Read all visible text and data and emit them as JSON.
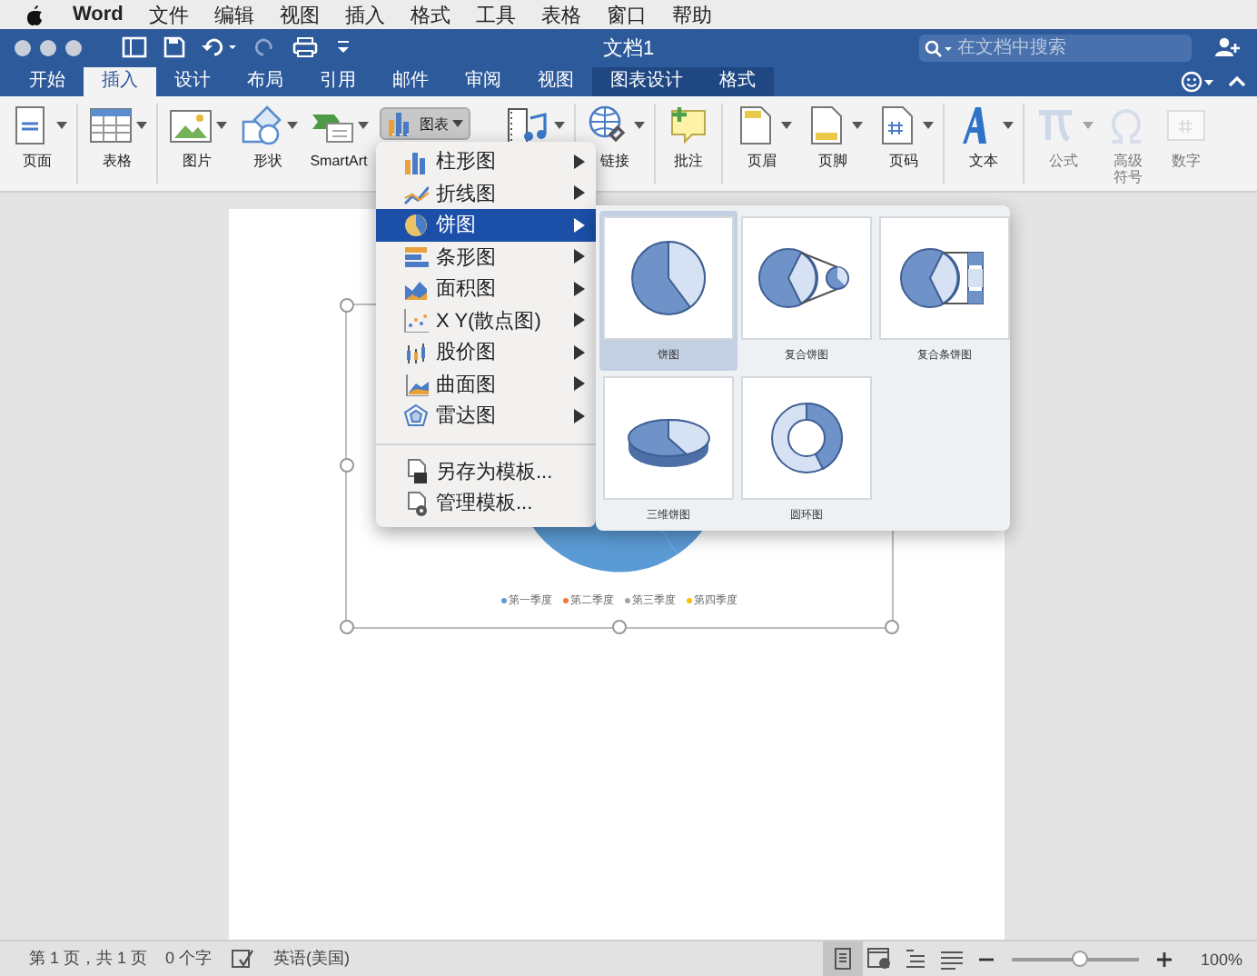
{
  "menu_bar": {
    "app": "Word",
    "items": [
      "文件",
      "编辑",
      "视图",
      "插入",
      "格式",
      "工具",
      "表格",
      "窗口",
      "帮助"
    ]
  },
  "title_bar": {
    "title": "文档1",
    "search": {
      "placeholder": "在文档中搜索"
    }
  },
  "tabs": [
    {
      "label": "开始",
      "selected": false,
      "kind": "normal"
    },
    {
      "label": "插入",
      "selected": true,
      "kind": "normal"
    },
    {
      "label": "设计",
      "selected": false,
      "kind": "normal"
    },
    {
      "label": "布局",
      "selected": false,
      "kind": "normal"
    },
    {
      "label": "引用",
      "selected": false,
      "kind": "normal"
    },
    {
      "label": "邮件",
      "selected": false,
      "kind": "normal"
    },
    {
      "label": "审阅",
      "selected": false,
      "kind": "normal"
    },
    {
      "label": "视图",
      "selected": false,
      "kind": "normal"
    },
    {
      "label": "图表设计",
      "selected": false,
      "kind": "context"
    },
    {
      "label": "格式",
      "selected": false,
      "kind": "context"
    }
  ],
  "ribbon": [
    {
      "label": "页面",
      "kind": "page",
      "has_menu": true,
      "disabled": false,
      "group_end": true
    },
    {
      "label": "表格",
      "kind": "table",
      "has_menu": true,
      "disabled": false,
      "group_end": true
    },
    {
      "label": "图片",
      "kind": "picture",
      "has_menu": true,
      "disabled": false,
      "group_end": false
    },
    {
      "label": "形状",
      "kind": "shapes",
      "has_menu": true,
      "disabled": false,
      "group_end": false
    },
    {
      "label": "SmartArt",
      "kind": "smartart",
      "has_menu": true,
      "disabled": false,
      "group_end": false
    },
    {
      "label": "图表",
      "kind": "chart",
      "has_menu": true,
      "disabled": false,
      "expanded": true,
      "group_end": true
    },
    {
      "kind": "media",
      "has_menu": true,
      "disabled": false,
      "group_end": true
    },
    {
      "label": "链接",
      "kind": "link",
      "has_menu": true,
      "disabled": false,
      "group_end": true
    },
    {
      "label": "批注",
      "kind": "comment",
      "has_menu": false,
      "disabled": false,
      "group_end": true
    },
    {
      "label": "页眉",
      "kind": "header",
      "has_menu": true,
      "disabled": false,
      "group_end": false
    },
    {
      "label": "页脚",
      "kind": "footer",
      "has_menu": true,
      "disabled": false,
      "group_end": false
    },
    {
      "label": "页码",
      "kind": "pagenum",
      "has_menu": true,
      "disabled": false,
      "group_end": true
    },
    {
      "label": "文本",
      "kind": "text",
      "has_menu": true,
      "disabled": false,
      "group_end": true
    },
    {
      "label": "公式",
      "kind": "equation",
      "has_menu": true,
      "disabled": true,
      "group_end": false
    },
    {
      "label": "高级符号",
      "kind": "symbol",
      "has_menu": false,
      "disabled": true,
      "group_end": false
    },
    {
      "label": "数字",
      "kind": "number",
      "has_menu": false,
      "disabled": true,
      "group_end": false
    }
  ],
  "chart_menu": {
    "types": [
      {
        "label": "柱形图",
        "kind": "column",
        "selected": false
      },
      {
        "label": "折线图",
        "kind": "line",
        "selected": false
      },
      {
        "label": "饼图",
        "kind": "pie",
        "selected": true
      },
      {
        "label": "条形图",
        "kind": "bar",
        "selected": false
      },
      {
        "label": "面积图",
        "kind": "area",
        "selected": false
      },
      {
        "label": "X Y(散点图)",
        "kind": "scatter",
        "selected": false
      },
      {
        "label": "股价图",
        "kind": "stock",
        "selected": false
      },
      {
        "label": "曲面图",
        "kind": "surface",
        "selected": false
      },
      {
        "label": "雷达图",
        "kind": "radar",
        "selected": false
      }
    ],
    "templates": [
      {
        "label": "另存为模板...",
        "kind": "save"
      },
      {
        "label": "管理模板...",
        "kind": "manage"
      }
    ]
  },
  "pie_gallery": [
    {
      "label": "饼图",
      "kind": "pie",
      "selected": true
    },
    {
      "label": "复合饼图",
      "kind": "pie_of_pie",
      "selected": false
    },
    {
      "label": "复合条饼图",
      "kind": "bar_of_pie",
      "selected": false
    },
    {
      "label": "三维饼图",
      "kind": "pie_3d",
      "selected": false
    },
    {
      "label": "圆环图",
      "kind": "donut",
      "selected": false
    }
  ],
  "chart_legend": [
    {
      "label": "第一季度",
      "color": "#5b9bd5"
    },
    {
      "label": "第二季度",
      "color": "#ed7d31"
    },
    {
      "label": "第三季度",
      "color": "#a5a5a5"
    },
    {
      "label": "第四季度",
      "color": "#ffc000"
    }
  ],
  "status_bar": {
    "page": "第 1 页，共 1 页",
    "words": "0 个字",
    "language": "英语(美国)",
    "views": [
      {
        "kind": "print",
        "selected": true
      },
      {
        "kind": "web",
        "selected": false
      },
      {
        "kind": "outline",
        "selected": false
      },
      {
        "kind": "draft",
        "selected": false
      }
    ],
    "zoom": {
      "level": 0.55,
      "reading": "100%"
    }
  }
}
